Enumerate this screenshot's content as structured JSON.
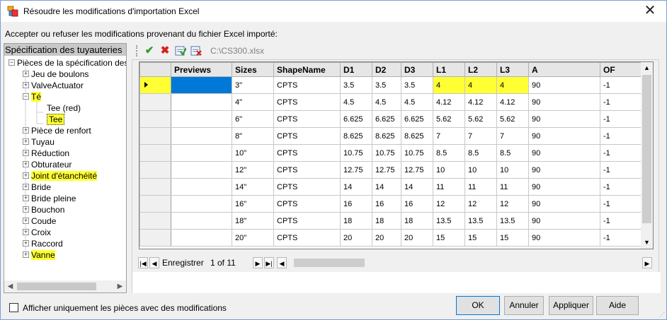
{
  "window": {
    "title": "Résoudre les modifications d'importation Excel",
    "instruction": "Accepter ou refuser les modifications provenant du fichier Excel importé:"
  },
  "tree": {
    "header": "Spécification des tuyauteries",
    "root": "Pièces de la spécification des tuyauteries",
    "items": [
      {
        "label": "Jeu de boulons",
        "highlighted": false
      },
      {
        "label": "ValveActuator",
        "highlighted": false
      },
      {
        "label": "Té",
        "highlighted": true
      },
      {
        "label": "Tee (red)",
        "highlighted": false
      },
      {
        "label": "Tee",
        "highlighted": true
      },
      {
        "label": "Pièce de renfort",
        "highlighted": false
      },
      {
        "label": "Tuyau",
        "highlighted": false
      },
      {
        "label": "Réduction",
        "highlighted": false
      },
      {
        "label": "Obturateur",
        "highlighted": false
      },
      {
        "label": "Joint d'étanchéité",
        "highlighted": true
      },
      {
        "label": "Bride",
        "highlighted": false
      },
      {
        "label": "Bride pleine",
        "highlighted": false
      },
      {
        "label": "Bouchon",
        "highlighted": false
      },
      {
        "label": "Coude",
        "highlighted": false
      },
      {
        "label": "Croix",
        "highlighted": false
      },
      {
        "label": "Raccord",
        "highlighted": false
      },
      {
        "label": "Vanne",
        "highlighted": true
      }
    ]
  },
  "toolbar": {
    "accept_icon": "check-icon",
    "reject_icon": "x-icon",
    "accept_all_icon": "accept-all-icon",
    "reject_all_icon": "reject-all-icon",
    "file": "C:\\CS300.xlsx"
  },
  "grid": {
    "columns": [
      "Previews",
      "Sizes",
      "ShapeName",
      "D1",
      "D2",
      "D3",
      "L1",
      "L2",
      "L3",
      "A",
      "OF"
    ],
    "rows": [
      [
        "",
        "3\"",
        "CPTS",
        "3.5",
        "3.5",
        "3.5",
        "4",
        "4",
        "4",
        "90",
        "-1"
      ],
      [
        "",
        "4\"",
        "CPTS",
        "4.5",
        "4.5",
        "4.5",
        "4.12",
        "4.12",
        "4.12",
        "90",
        "-1"
      ],
      [
        "",
        "6\"",
        "CPTS",
        "6.625",
        "6.625",
        "6.625",
        "5.62",
        "5.62",
        "5.62",
        "90",
        "-1"
      ],
      [
        "",
        "8\"",
        "CPTS",
        "8.625",
        "8.625",
        "8.625",
        "7",
        "7",
        "7",
        "90",
        "-1"
      ],
      [
        "",
        "10\"",
        "CPTS",
        "10.75",
        "10.75",
        "10.75",
        "8.5",
        "8.5",
        "8.5",
        "90",
        "-1"
      ],
      [
        "",
        "12\"",
        "CPTS",
        "12.75",
        "12.75",
        "12.75",
        "10",
        "10",
        "10",
        "90",
        "-1"
      ],
      [
        "",
        "14\"",
        "CPTS",
        "14",
        "14",
        "14",
        "11",
        "11",
        "11",
        "90",
        "-1"
      ],
      [
        "",
        "16\"",
        "CPTS",
        "16",
        "16",
        "16",
        "12",
        "12",
        "12",
        "90",
        "-1"
      ],
      [
        "",
        "18\"",
        "CPTS",
        "18",
        "18",
        "18",
        "13.5",
        "13.5",
        "13.5",
        "90",
        "-1"
      ],
      [
        "",
        "20\"",
        "CPTS",
        "20",
        "20",
        "20",
        "15",
        "15",
        "15",
        "90",
        "-1"
      ]
    ],
    "changed_cells": [
      [
        0,
        6
      ],
      [
        0,
        7
      ],
      [
        0,
        8
      ]
    ],
    "selected_cell": [
      0,
      0
    ],
    "highlight_color": "#ffff33",
    "selection_color": "#0078d7"
  },
  "navigator": {
    "label": "Enregistrer",
    "position": "1 of 11"
  },
  "footer": {
    "checkbox_label": "Afficher uniquement les pièces avec des modifications",
    "checkbox_checked": false,
    "ok": "OK",
    "cancel": "Annuler",
    "apply": "Appliquer",
    "help": "Aide"
  }
}
